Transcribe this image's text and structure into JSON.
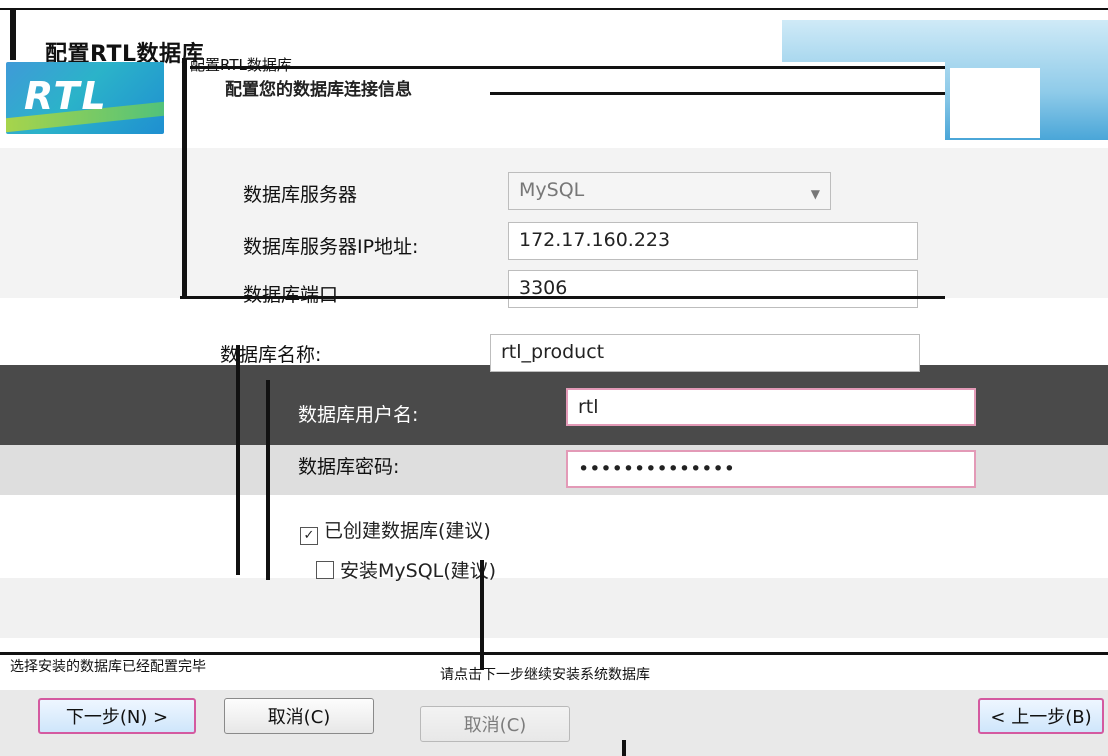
{
  "window": {
    "outer_title": "配置RTL数据库",
    "inner_header": "配置RTL数据库",
    "inner_title": "配置您的数据库连接信息"
  },
  "banner": {
    "logo_text": "RTL"
  },
  "form": {
    "server_label": "数据库服务器",
    "server_value": "MySQL",
    "ip_label": "数据库服务器IP地址:",
    "ip_value": "172.17.160.223",
    "port_label": "数据库端口",
    "port_value": "3306",
    "dbname_label": "数据库名称:",
    "dbname_value": "rtl_product",
    "user_label": "数据库用户名:",
    "user_value": "rtl",
    "password_label": "数据库密码:",
    "password_value": "••••••••••••••",
    "checkbox1_label": "已创建数据库(建议)",
    "checkbox2_label": "安装MySQL(建议)"
  },
  "footer": {
    "status_text": "选择安装的数据库已经配置完毕",
    "hint_text": "请点击下一步继续安装系统数据库"
  },
  "buttons": {
    "next_label": "下一步(N) >",
    "cancel_label": "取消(C)",
    "back_label": "< 上一步(B)"
  },
  "colors": {
    "accent_pink": "#d45aa0",
    "banner_blue": "#3f9ad8",
    "input_border_pink": "#e39ab7"
  }
}
